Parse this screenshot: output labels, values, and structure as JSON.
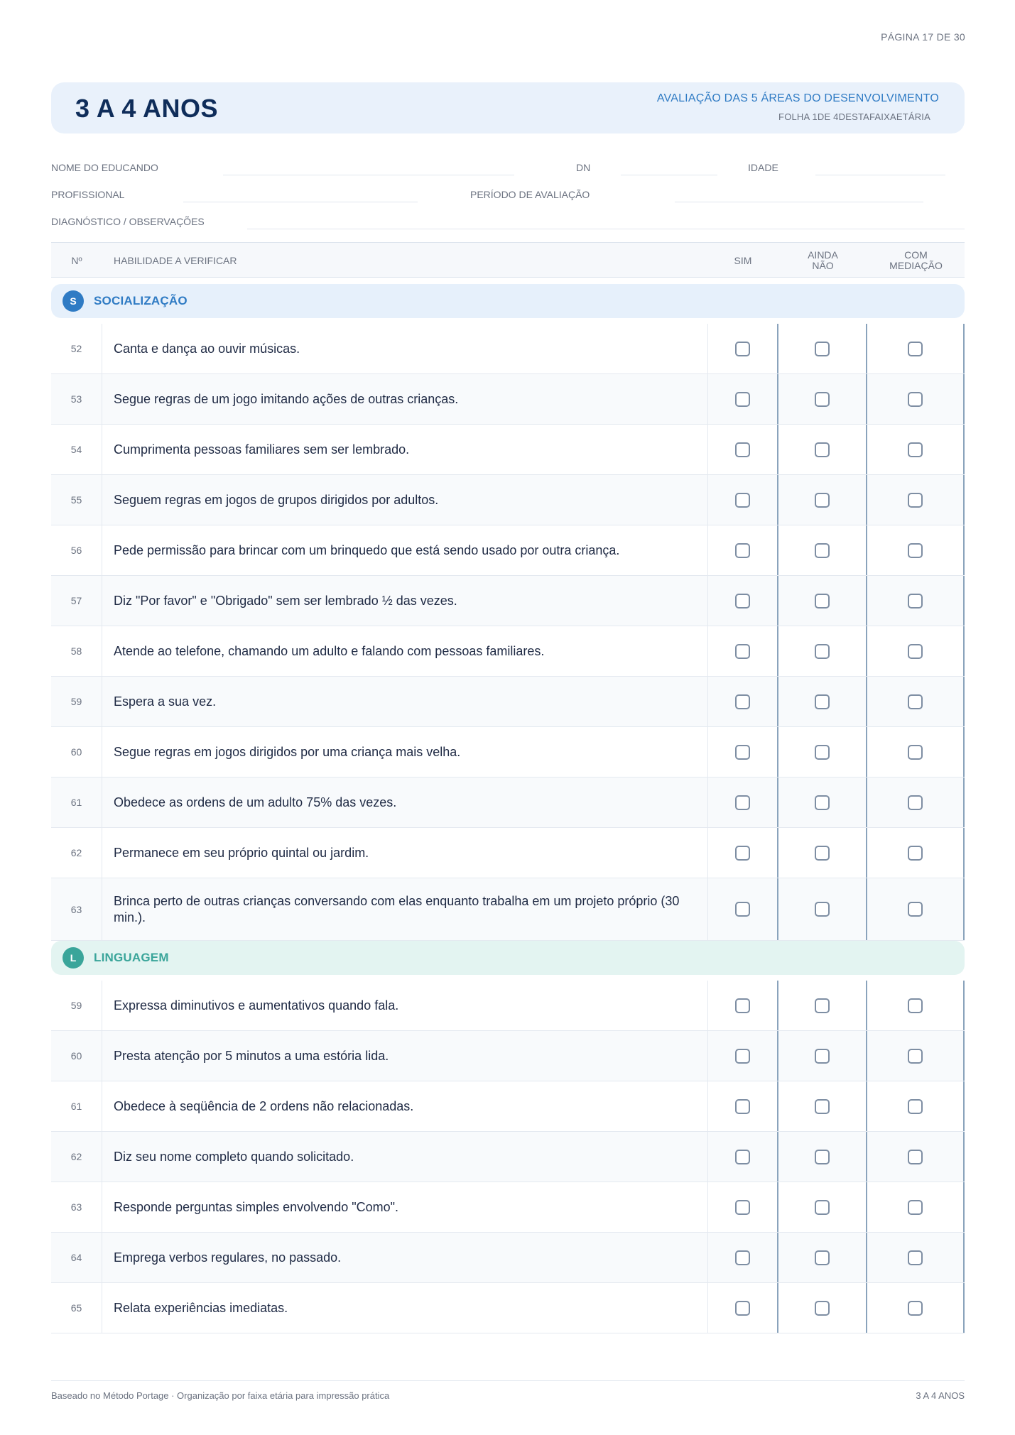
{
  "page": {
    "number_label": "PÁGINA 17 DE 30"
  },
  "header": {
    "age_title": "3 A 4 ANOS",
    "subtitle": "AVALIAÇÃO DAS 5 ÁREAS DO DESENVOLVIMENTO",
    "sheet_label": "FOLHA 1DE 4DESTAFAIXAETÁRIA"
  },
  "fields": {
    "student_name": "NOME DO EDUCANDO",
    "dn": "DN",
    "age": "IDADE",
    "professional": "PROFISSIONAL",
    "evaluation_period": "PERÍODO DE AVALIAÇÃO",
    "diagnosis": "DIAGNÓSTICO / OBSERVAÇÕES"
  },
  "table_header": {
    "number": "Nº",
    "skill": "HABILIDADE A VERIFICAR",
    "yes": "SIM",
    "not_yet_1": "AINDA",
    "not_yet_2": "NÃO",
    "mediation_1": "COM",
    "mediation_2": "MEDIAÇÃO"
  },
  "sections": [
    {
      "badge": "S",
      "title": "SOCIALIZAÇÃO",
      "items": [
        {
          "num": "52",
          "text": "Canta e dança ao ouvir músicas."
        },
        {
          "num": "53",
          "text": "Segue regras de um jogo imitando ações de outras crianças."
        },
        {
          "num": "54",
          "text": "Cumprimenta pessoas familiares sem ser lembrado."
        },
        {
          "num": "55",
          "text": "Seguem regras em jogos de grupos dirigidos por adultos."
        },
        {
          "num": "56",
          "text": "Pede permissão para brincar com um brinquedo que está sendo usado por outra criança."
        },
        {
          "num": "57",
          "text": "Diz \"Por favor\" e \"Obrigado\" sem ser lembrado ½ das vezes."
        },
        {
          "num": "58",
          "text": "Atende ao telefone, chamando um adulto e falando com pessoas familiares."
        },
        {
          "num": "59",
          "text": "Espera a sua vez."
        },
        {
          "num": "60",
          "text": "Segue regras em jogos dirigidos por uma criança mais velha."
        },
        {
          "num": "61",
          "text": "Obedece as ordens de um adulto 75% das vezes."
        },
        {
          "num": "62",
          "text": "Permanece em seu próprio quintal ou jardim."
        },
        {
          "num": "63",
          "text": "Brinca perto de outras crianças conversando com elas enquanto trabalha em um projeto próprio (30 min.)."
        }
      ]
    },
    {
      "badge": "L",
      "title": "LINGUAGEM",
      "items": [
        {
          "num": "59",
          "text": "Expressa diminutivos e aumentativos quando fala."
        },
        {
          "num": "60",
          "text": "Presta atenção por 5 minutos a uma estória lida."
        },
        {
          "num": "61",
          "text": "Obedece à seqüência de 2 ordens não relacionadas."
        },
        {
          "num": "62",
          "text": "Diz seu nome completo quando solicitado."
        },
        {
          "num": "63",
          "text": "Responde perguntas simples envolvendo \"Como\"."
        },
        {
          "num": "64",
          "text": "Emprega verbos regulares, no passado."
        },
        {
          "num": "65",
          "text": "Relata experiências imediatas."
        }
      ]
    }
  ],
  "footer": {
    "left": "Baseado no Método Portage · Organização por faixa etária para impressão prática",
    "right": "3 A 4 ANOS"
  }
}
